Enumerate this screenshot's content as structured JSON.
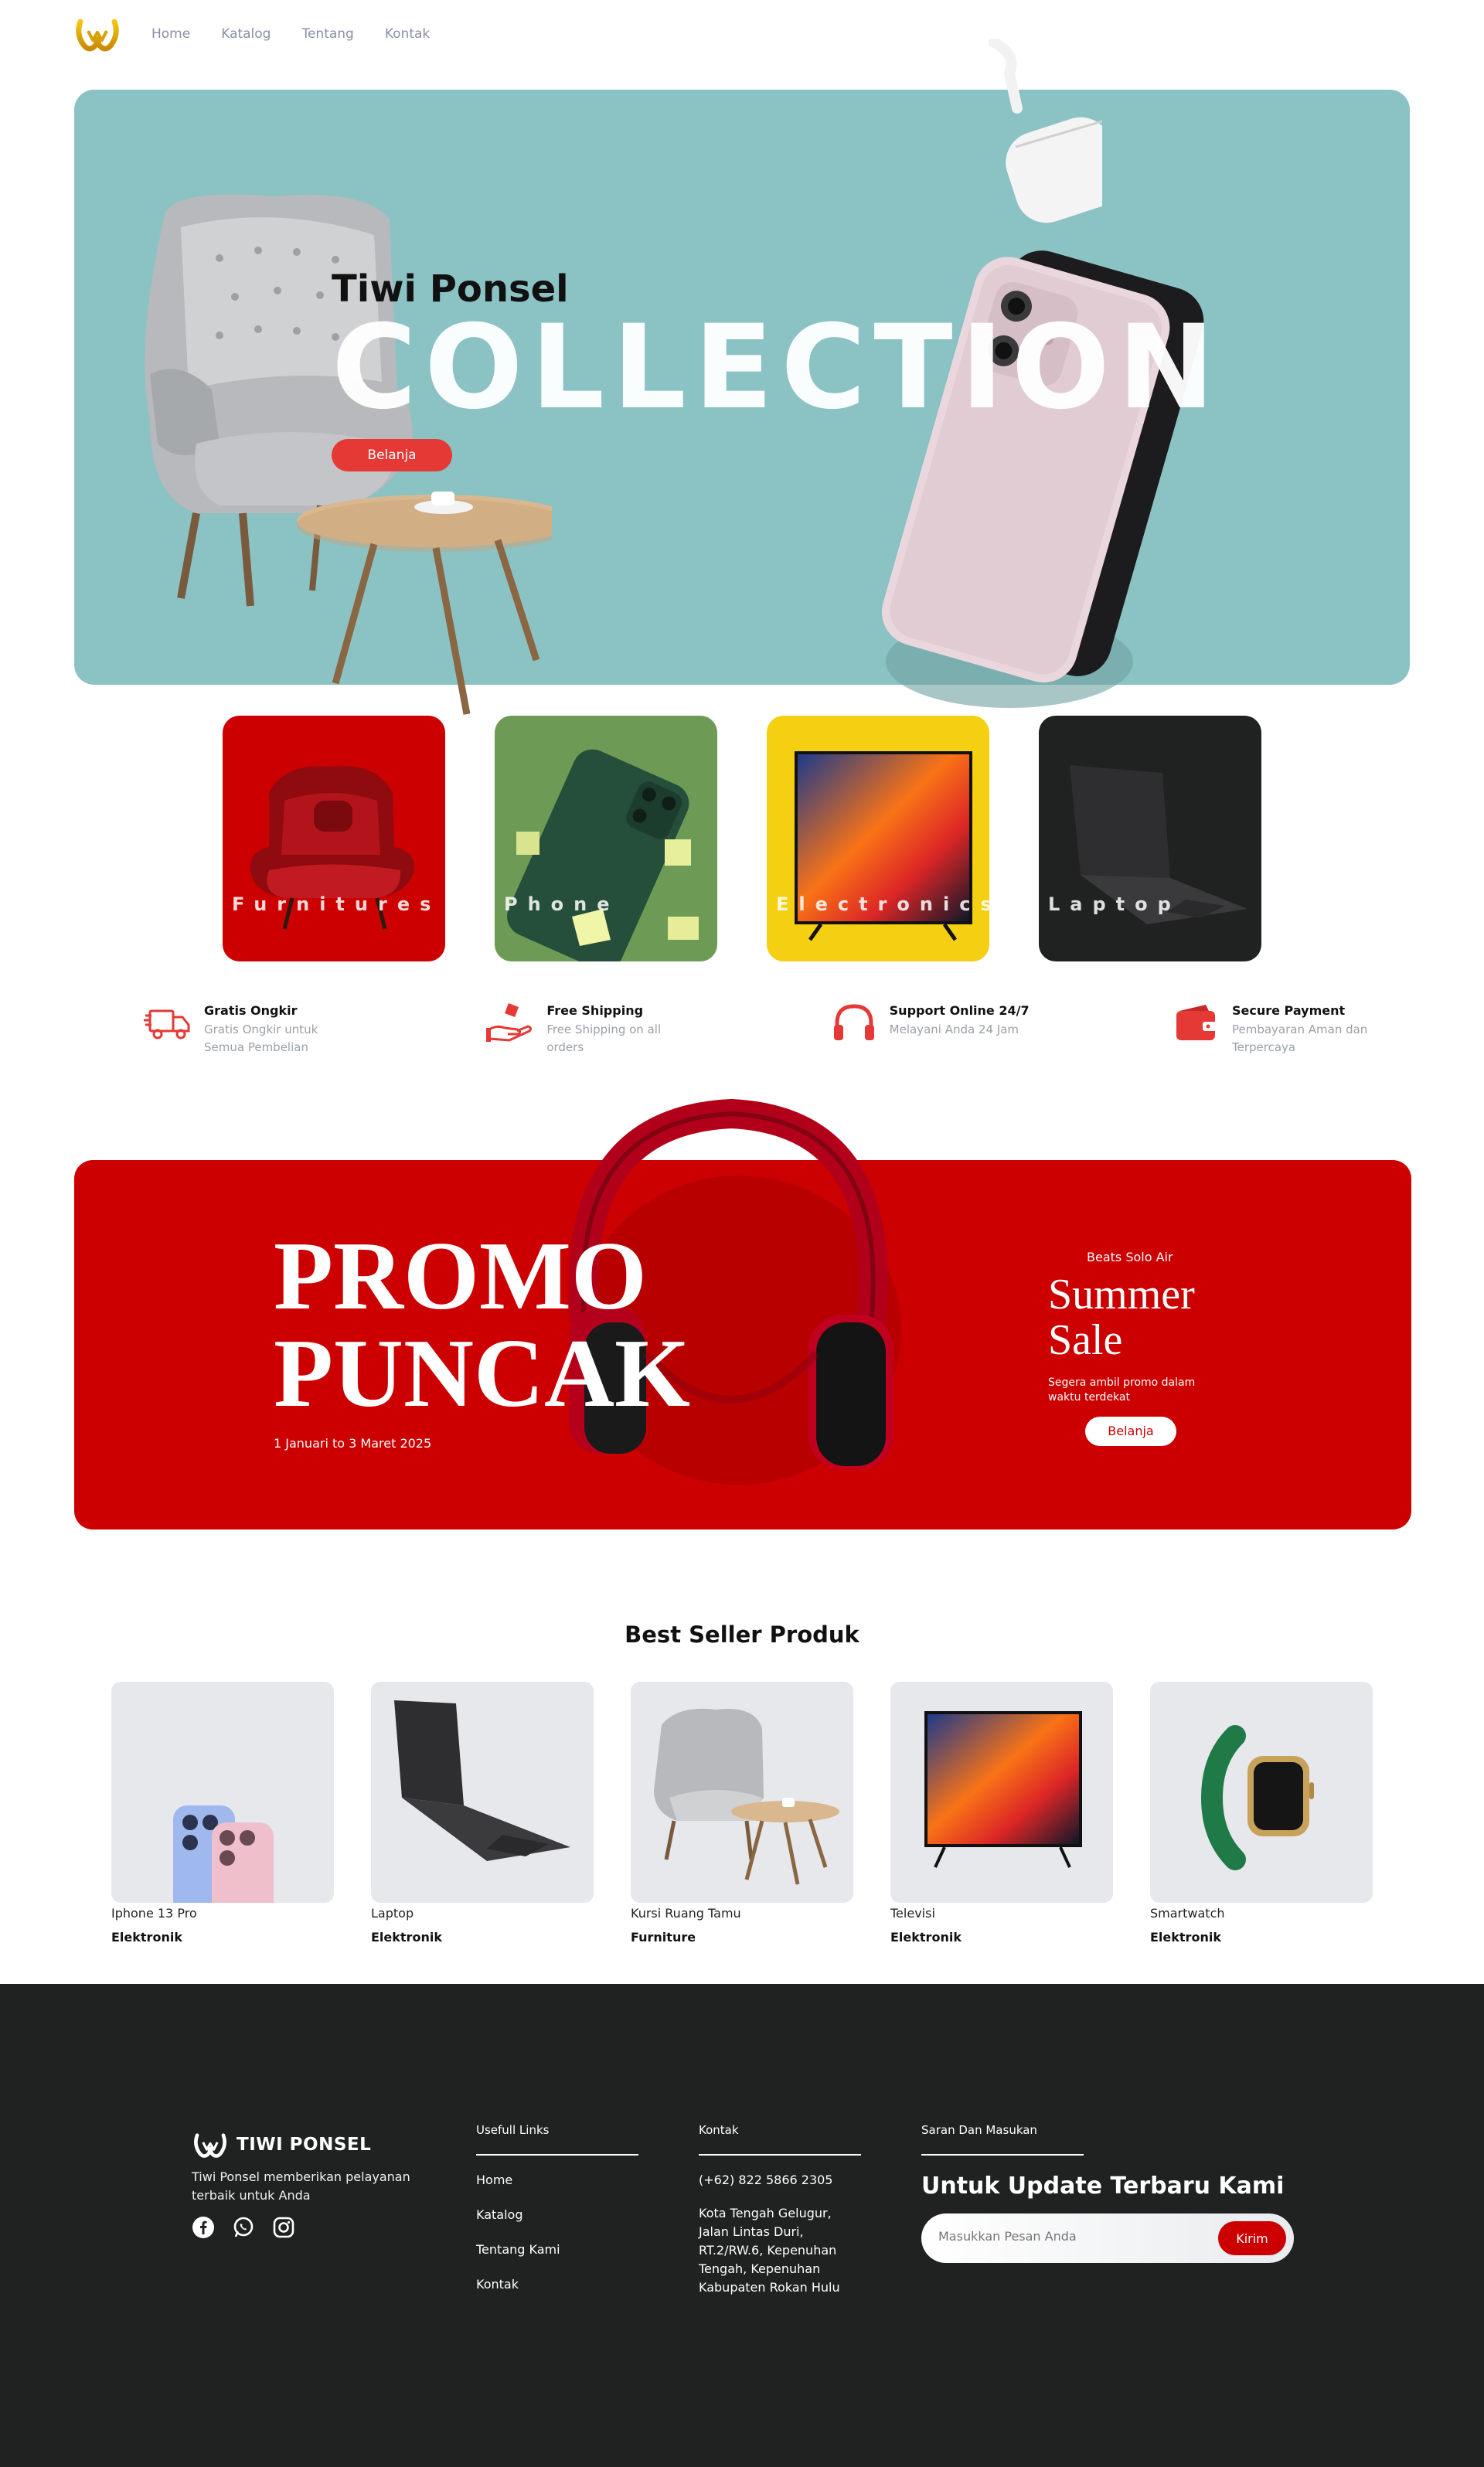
{
  "nav": {
    "links": [
      "Home",
      "Katalog",
      "Tentang",
      "Kontak"
    ]
  },
  "hero": {
    "subtitle": "Tiwi Ponsel",
    "headline": "COLLECTION",
    "cta": "Belanja",
    "bg_color": "#8bc2c4"
  },
  "categories": [
    {
      "label": "Furnitures",
      "color": "#cc0000"
    },
    {
      "label": "Phone",
      "color": "#6d9a55"
    },
    {
      "label": "Electronics",
      "color": "#f5cf12"
    },
    {
      "label": "Laptop",
      "color": "#202121"
    }
  ],
  "features": [
    {
      "icon": "truck-icon",
      "title": "Gratis Ongkir",
      "desc": "Gratis Ongkir untuk Semua Pembelian"
    },
    {
      "icon": "hand-box-icon",
      "title": "Free Shipping",
      "desc": "Free Shipping on all orders"
    },
    {
      "icon": "headset-icon",
      "title": "Support Online 24/7",
      "desc": "Melayani Anda 24 Jam"
    },
    {
      "icon": "wallet-icon",
      "title": "Secure Payment",
      "desc": "Pembayaran Aman dan Terpercaya"
    }
  ],
  "promo": {
    "title_line1": "PROMO",
    "title_line2": "PUNCAK",
    "date": "1 Januari to 3 Maret 2025",
    "brand": "Beats Solo Air",
    "sale_line1": "Summer",
    "sale_line2": "Sale",
    "desc": "Segera ambil promo dalam waktu terdekat",
    "cta": "Belanja",
    "color": "#cc0000"
  },
  "best_seller": {
    "title": "Best Seller Produk",
    "products": [
      {
        "name": "Iphone 13 Pro",
        "category": "Elektronik"
      },
      {
        "name": "Laptop",
        "category": "Elektronik"
      },
      {
        "name": "Kursi Ruang Tamu",
        "category": "Furniture"
      },
      {
        "name": "Televisi",
        "category": "Elektronik"
      },
      {
        "name": "Smartwatch",
        "category": "Elektronik"
      }
    ]
  },
  "footer": {
    "brand_name": "TIWI PONSEL",
    "tagline": "Tiwi Ponsel memberikan pelayanan terbaik untuk Anda",
    "links_heading": "Usefull Links",
    "links": [
      "Home",
      "Katalog",
      "Tentang Kami",
      "Kontak"
    ],
    "contact_heading": "Kontak",
    "phone": "(+62) 822 5866 2305",
    "address": "Kota Tengah Gelugur, Jalan Lintas Duri, RT.2/RW.6, Kepenuhan Tengah, Kepenuhan Kabupaten Rokan Hulu",
    "feedback_heading": "Saran Dan Masukan",
    "newsletter_title": "Untuk Update Terbaru Kami",
    "input_placeholder": "Masukkan Pesan Anda",
    "submit": "Kirim",
    "bg_color": "#202121"
  }
}
